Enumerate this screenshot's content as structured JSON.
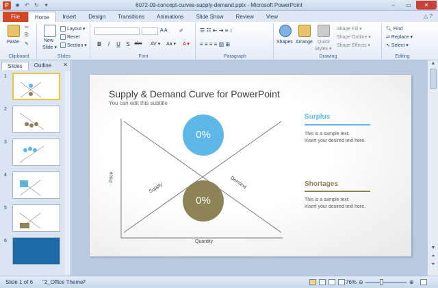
{
  "window": {
    "title": "6072-09-concept-curves-supply-demand.pptx - Microsoft PowerPoint"
  },
  "ribbon_tabs": [
    "File",
    "Home",
    "Insert",
    "Design",
    "Transitions",
    "Animations",
    "Slide Show",
    "Review",
    "View"
  ],
  "ribbon": {
    "clipboard": {
      "label": "Clipboard",
      "paste": "Paste"
    },
    "slides": {
      "label": "Slides",
      "new_slide": "New Slide",
      "new_slide_line2": "Slide ▾",
      "new_line1": "New",
      "layout": "Layout ▾",
      "reset": "Reset",
      "section": "Section ▾"
    },
    "font": {
      "label": "Font",
      "bold": "B",
      "italic": "I",
      "underline": "U",
      "strike": "S",
      "abc": "abc",
      "av": "AV ▾",
      "aa": "Aa ▾",
      "color": "A ▾"
    },
    "paragraph": {
      "label": "Paragraph"
    },
    "drawing": {
      "label": "Drawing",
      "shapes": "Shapes",
      "arrange": "Arrange",
      "quick_styles": "Quick",
      "quick_styles_2": "Styles ▾",
      "shape_fill": "Shape Fill ▾",
      "shape_outline": "Shape Outline ▾",
      "shape_effects": "Shape Effects ▾"
    },
    "editing": {
      "label": "Editing",
      "find": "Find",
      "replace": "Replace ▾",
      "select": "Select ▾"
    }
  },
  "slides_pane": {
    "tabs": [
      "Slides",
      "Outline"
    ],
    "close": "✕",
    "numbers": [
      "1",
      "2",
      "3",
      "4",
      "5",
      "6"
    ]
  },
  "slide": {
    "title": "Supply & Demand Curve for PowerPoint",
    "subtitle": "You can edit this subtitle",
    "top_circle": "0%",
    "bottom_circle": "0%",
    "supply_label": "Supply",
    "demand_label": "Demand",
    "y_axis": "Price",
    "x_axis": "Quantity",
    "surplus": {
      "heading": "Surplus",
      "line1": "This is a sample text.",
      "line2": "Insert your desired text here."
    },
    "shortages": {
      "heading": "Shortages",
      "line1": "This is a sample text.",
      "line2": "Insert your desired text here."
    }
  },
  "colors": {
    "surplus": "#5db8e8",
    "shortages": "#8c8455",
    "file_tab": "#d24726"
  },
  "status": {
    "slide_info": "Slide 1 of 6",
    "theme": "\"2_Office Theme\"",
    "zoom": "76%",
    "zoom_minus": "⊖",
    "zoom_plus": "⊕"
  }
}
